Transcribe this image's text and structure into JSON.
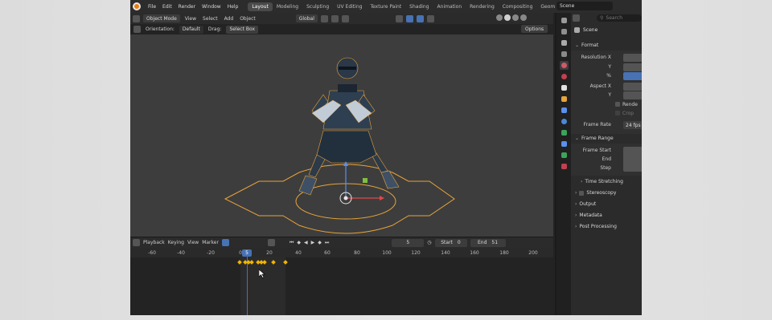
{
  "menu": [
    "File",
    "Edit",
    "Render",
    "Window",
    "Help"
  ],
  "workspaces": [
    "Layout",
    "Modeling",
    "Sculpting",
    "UV Editing",
    "Texture Paint",
    "Shading",
    "Animation",
    "Rendering",
    "Compositing",
    "Geom"
  ],
  "active_workspace": "Layout",
  "scene_name": "Scene",
  "viewport_header": {
    "mode": "Object Mode",
    "menus": [
      "View",
      "Select",
      "Add",
      "Object"
    ],
    "transform": "Global"
  },
  "viewport_tools": {
    "orientation_label": "Orientation:",
    "orientation_value": "Default",
    "drag_label": "Drag:",
    "drag_value": "Select Box",
    "options": "Options"
  },
  "timeline_header": {
    "menus": [
      "Playback",
      "Keying",
      "View",
      "Marker"
    ],
    "current_frame": "5",
    "start_label": "Start",
    "start_value": "0",
    "end_label": "End",
    "end_value": "51"
  },
  "timeline": {
    "ticks": [
      "-60",
      "-40",
      "-20",
      "0",
      "20",
      "40",
      "60",
      "80",
      "100",
      "120",
      "140",
      "160",
      "180",
      "200"
    ],
    "playhead_frame": "5"
  },
  "properties": {
    "search_placeholder": "Search",
    "title": "Scene",
    "format_section": "Format",
    "resolution_x": "Resolution X",
    "resolution_y": "Y",
    "resolution_pct": "%",
    "aspect_x": "Aspect X",
    "aspect_y": "Y",
    "render_region": "Rende",
    "crop_region": "Crop",
    "frame_rate_label": "Frame Rate",
    "frame_rate_value": "24 fps",
    "frame_range_section": "Frame Range",
    "frame_start": "Frame Start",
    "frame_end": "End",
    "frame_step": "Step",
    "time_stretching": "Time Stretching",
    "stereoscopy": "Stereoscopy",
    "output": "Output",
    "metadata": "Metadata",
    "post_processing": "Post Processing"
  },
  "colors": {
    "accent": "#4772b3",
    "selection_outline": "#e8a33a",
    "keyframe": "#f0b400"
  }
}
